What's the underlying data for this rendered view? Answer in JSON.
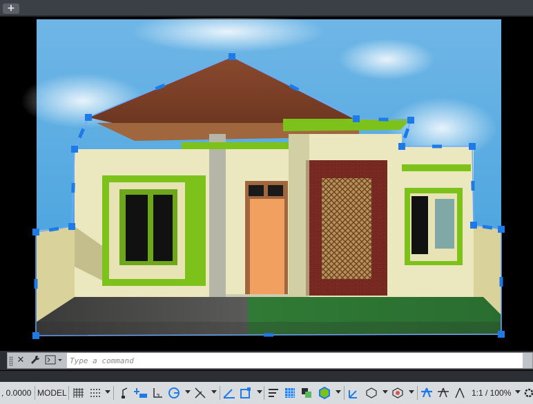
{
  "tabbar": {
    "new_tab_label": "+"
  },
  "commandline": {
    "placeholder": "Type a command",
    "close_icon": "close-icon",
    "settings_icon": "wrench-icon",
    "prompt_icon": "command-prompt-icon"
  },
  "statusbar": {
    "coordinates": ", 0.0000",
    "space": "MODEL",
    "annotation_scale": "1:1 / 100%"
  },
  "colors": {
    "sky": "#4fa8e0",
    "roof": "#7a3d24",
    "wall": "#ebe7bf",
    "trim_green": "#7cc21a",
    "door": "#f2a060",
    "brick": "#7b2b22",
    "grass": "#2f7a35",
    "grip": "#1e7ae6",
    "boundary": "#6fa8ff"
  }
}
